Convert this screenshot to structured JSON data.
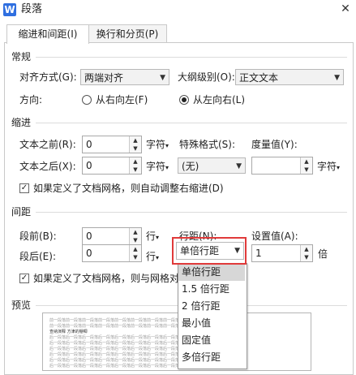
{
  "window": {
    "title": "段落",
    "app_icon": "W"
  },
  "tabs": [
    {
      "label": "缩进和间距(I)",
      "active": true
    },
    {
      "label": "换行和分页(P)",
      "active": false
    }
  ],
  "general": {
    "section": "常规",
    "alignment_label": "对齐方式(G):",
    "alignment_value": "两端对齐",
    "outline_label": "大纲级别(O):",
    "outline_value": "正文文本",
    "direction_label": "方向:",
    "direction_rtl": "从右向左(F)",
    "direction_ltr": "从左向右(L)",
    "direction_selected": "ltr"
  },
  "indent": {
    "section": "缩进",
    "before_label": "文本之前(R):",
    "before_value": "0",
    "before_unit": "字符",
    "after_label": "文本之后(X):",
    "after_value": "0",
    "after_unit": "字符",
    "special_label": "特殊格式(S):",
    "special_value": "(无)",
    "measure_label": "度量值(Y):",
    "measure_value": "",
    "measure_unit": "字符",
    "grid_check_label": "如果定义了文档网格，则自动调整右缩进(D)",
    "grid_checked": true
  },
  "spacing": {
    "section": "间距",
    "before_label": "段前(B):",
    "before_value": "0",
    "before_unit": "行",
    "after_label": "段后(E):",
    "after_value": "0",
    "after_unit": "行",
    "line_label": "行距(N):",
    "line_value": "单倍行距",
    "setting_label": "设置值(A):",
    "setting_value": "1",
    "setting_unit": "倍",
    "grid_check_label": "如果定义了文档网格，则与网格对",
    "grid_checked": true
  },
  "line_dropdown": {
    "options": [
      "单倍行距",
      "1.5 倍行距",
      "2 倍行距",
      "最小值",
      "固定值",
      "多倍行距"
    ],
    "selected_index": 0
  },
  "preview": {
    "section": "预览",
    "lines": [
      "前一段落前一段落前一段落前一段落前一段落前一段落前一段落前一段落前一段落前一段落前一段落",
      "前一段落前一段落前一段落前一段落前一段落前一段落前一段落前一段落前一段落前一段落前一段落",
      "查纳演释 方津的棚唧",
      "后一段落后一段落后一段落后一段落后一段落后一段落后一段落后一段落后一段落后一段落后一段落",
      "后一段落后一段落后一段落后一段落后一段落后一段落后一段落后一段落后一段落后一段落后一段落",
      "后一段落后一段落后一段落后一段落后一段落后一段落后一段落后一段落后一段落后一段落后一段落",
      "后一段落后一段落后一段落后一段落后一段落后一段落后一段落后一段落后一段落后一段落后一段落",
      "后一段落后一段落后一段落后一段落后一段落后一段落后一段落后一段落后一段落后一段落后一段落",
      "后一段落后一段落后一段落后一段落后一段落后一段落后一段落后一段落后一段落后一段落后一段落"
    ]
  },
  "colors": {
    "highlight": "#e03a3a",
    "app_icon": "#2f6fe0",
    "dropdown_selected": "#d7d7d7"
  }
}
